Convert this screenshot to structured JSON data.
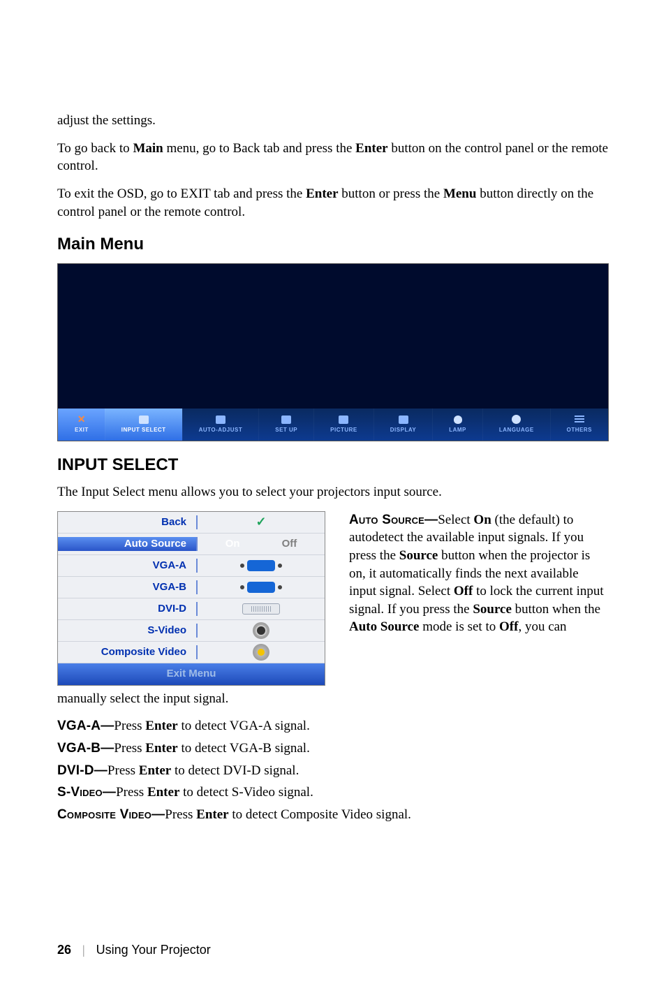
{
  "intro": {
    "adjust": "adjust the settings.",
    "back_pre": "To go back to ",
    "back_main": "Main",
    "back_mid": " menu, go to Back tab and press the ",
    "enter1": "Enter",
    "back_post": " button on the control panel or the remote control.",
    "exit_pre": "To exit the OSD, go to EXIT tab and press the ",
    "enter2": "Enter",
    "exit_mid": " button or press the ",
    "menu": "Menu",
    "exit_post": " button directly on the control panel or the remote control."
  },
  "main_menu": {
    "heading": "Main Menu",
    "tabs": {
      "exit": "EXIT",
      "input_select": "INPUT SELECT",
      "auto_adjust": "AUTO-ADJUST",
      "set_up": "SET UP",
      "picture": "PICTURE",
      "display": "DISPLAY",
      "lamp": "LAMP",
      "language": "LANGUAGE",
      "others": "OTHERS"
    }
  },
  "input_select": {
    "heading": "INPUT SELECT",
    "desc": "The Input Select menu allows you to select your projectors input source.",
    "menu": {
      "back": "Back",
      "auto_source": "Auto Source",
      "on": "On",
      "off": "Off",
      "vga_a": "VGA-A",
      "vga_b": "VGA-B",
      "dvi_d": "DVI-D",
      "s_video": "S-Video",
      "composite": "Composite Video",
      "exit_menu": "Exit Menu"
    },
    "auto_source_para": {
      "label": "Auto Source—",
      "p1": "Select ",
      "on": "On",
      "p2": " (the default) to autodetect the available input signals. If you press the ",
      "source1": "Source",
      "p3": " button when the projector is on, it automatically finds the next available input signal. Select ",
      "off": "Off",
      "p4": " to lock the current input signal. If you press the ",
      "source2": "Source",
      "p5": " button when the ",
      "as": "Auto Source",
      "p6": " mode is set to ",
      "off2": "Off",
      "p7": ", you can "
    },
    "tail": "manually select the input signal.",
    "defs": {
      "vga_a": {
        "label": "VGA-A—",
        "pre": "Press ",
        "enter": "Enter",
        "post": " to detect VGA-A signal."
      },
      "vga_b": {
        "label": "VGA-B—",
        "pre": "Press ",
        "enter": "Enter",
        "post": " to detect VGA-B signal."
      },
      "dvi_d": {
        "label": "DVI-D—",
        "pre": "Press ",
        "enter": "Enter",
        "post": " to detect DVI-D signal."
      },
      "s_video": {
        "label": "S-Video—",
        "pre": "Press ",
        "enter": "Enter",
        "post": " to detect S-Video signal."
      },
      "composite": {
        "label": "Composite Video—",
        "pre": "Press ",
        "enter": "Enter",
        "post": " to detect Composite Video signal."
      }
    }
  },
  "footer": {
    "page": "26",
    "chapter": "Using Your Projector"
  }
}
